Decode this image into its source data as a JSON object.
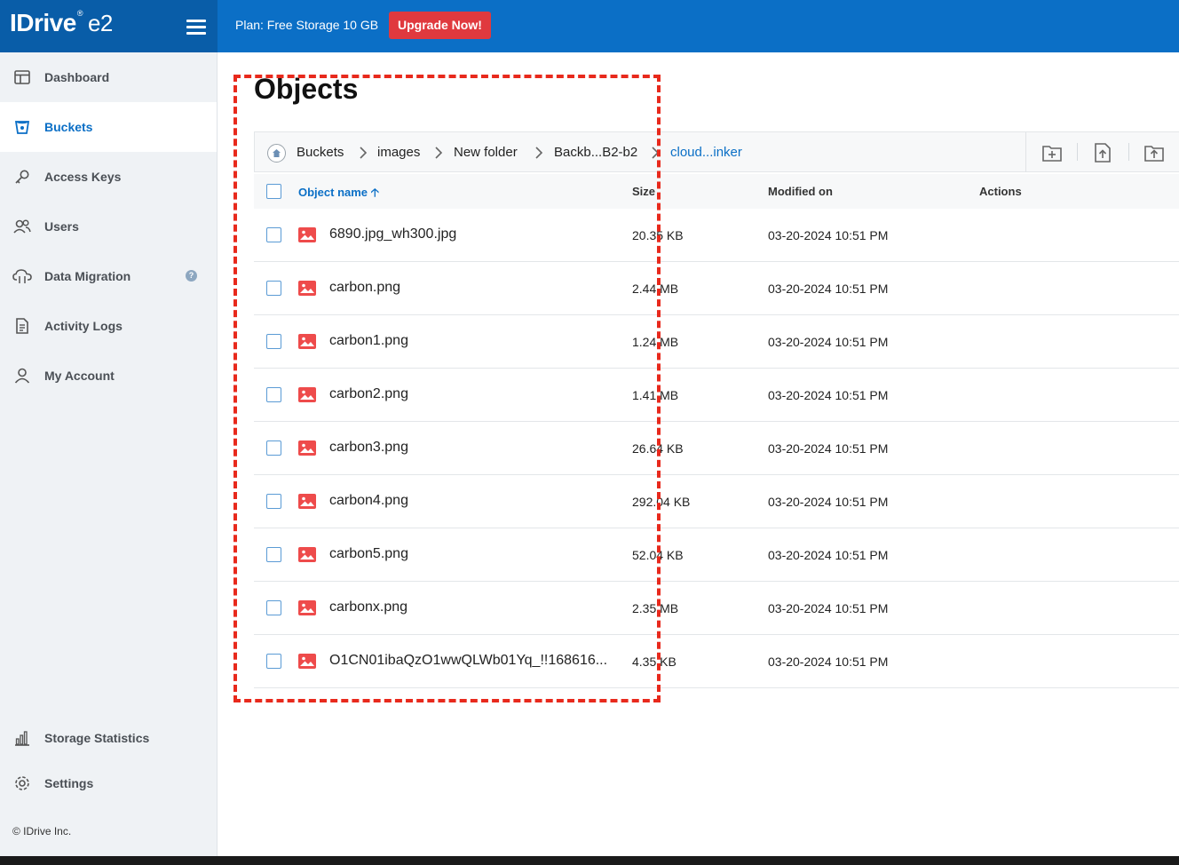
{
  "header": {
    "logo_text": "IDrive",
    "logo_sup": "®",
    "logo_suffix": "e2",
    "plan_label": "Plan: Free Storage 10 GB",
    "upgrade_label": "Upgrade Now!"
  },
  "sidebar": {
    "items": [
      {
        "label": "Dashboard",
        "icon": "dashboard-icon",
        "active": false
      },
      {
        "label": "Buckets",
        "icon": "bucket-icon",
        "active": true
      },
      {
        "label": "Access Keys",
        "icon": "key-icon",
        "active": false
      },
      {
        "label": "Users",
        "icon": "users-icon",
        "active": false
      },
      {
        "label": "Data Migration",
        "icon": "cloud-migration-icon",
        "active": false
      },
      {
        "label": "Activity Logs",
        "icon": "document-icon",
        "active": false
      },
      {
        "label": "My Account",
        "icon": "user-icon",
        "active": false
      }
    ],
    "bottom_items": [
      {
        "label": "Storage Statistics",
        "icon": "bar-chart-icon"
      },
      {
        "label": "Settings",
        "icon": "gear-icon"
      }
    ],
    "copyright": "© IDrive Inc."
  },
  "main": {
    "title": "Objects",
    "breadcrumb": [
      "Buckets",
      "images",
      "New folder",
      "Backb...B2-b2",
      "cloud...inker"
    ],
    "table": {
      "columns": {
        "name": "Object name",
        "size": "Size",
        "modified": "Modified on",
        "actions": "Actions"
      },
      "rows": [
        {
          "name": "6890.jpg_wh300.jpg",
          "size": "20.35 KB",
          "modified": "03-20-2024 10:51 PM"
        },
        {
          "name": "carbon.png",
          "size": "2.44 MB",
          "modified": "03-20-2024 10:51 PM"
        },
        {
          "name": "carbon1.png",
          "size": "1.24 MB",
          "modified": "03-20-2024 10:51 PM"
        },
        {
          "name": "carbon2.png",
          "size": "1.41 MB",
          "modified": "03-20-2024 10:51 PM"
        },
        {
          "name": "carbon3.png",
          "size": "26.64 KB",
          "modified": "03-20-2024 10:51 PM"
        },
        {
          "name": "carbon4.png",
          "size": "292.04 KB",
          "modified": "03-20-2024 10:51 PM"
        },
        {
          "name": "carbon5.png",
          "size": "52.04 KB",
          "modified": "03-20-2024 10:51 PM"
        },
        {
          "name": "carbonx.png",
          "size": "2.35 MB",
          "modified": "03-20-2024 10:51 PM"
        },
        {
          "name": "O1CN01ibaQzO1wwQLWb01Yq_!!168616...",
          "size": "4.35 KB",
          "modified": "03-20-2024 10:51 PM"
        }
      ]
    }
  },
  "colors": {
    "header_blue": "#0b6fc6",
    "brand_blue": "#095da8",
    "upgrade_red": "#e0393e",
    "highlight_red": "#e8291c",
    "file_icon_red": "#ee4b4b"
  }
}
